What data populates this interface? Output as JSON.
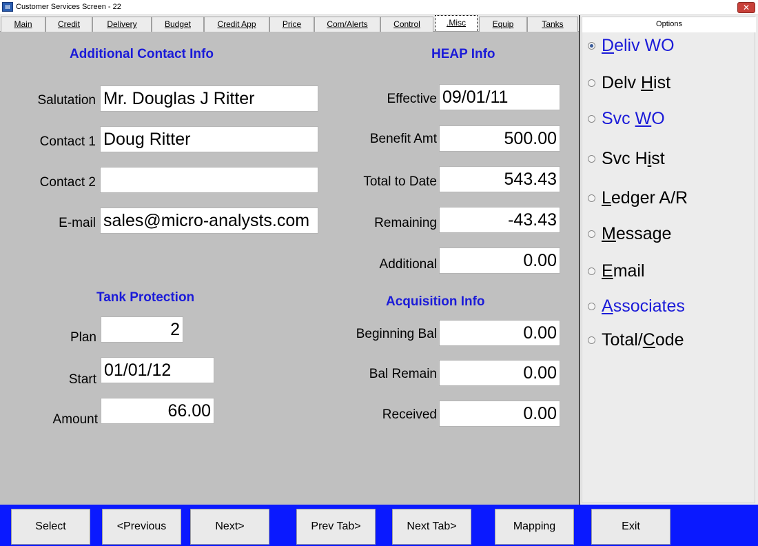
{
  "window": {
    "title": "Customer Services Screen - 22"
  },
  "tabs": [
    {
      "label": "Main"
    },
    {
      "label": "Credit"
    },
    {
      "label": "Delivery"
    },
    {
      "label": "Budget"
    },
    {
      "label": "Credit App"
    },
    {
      "label": "Price"
    },
    {
      "label": "Com/Alerts"
    },
    {
      "label": "Control"
    },
    {
      "label": ".Misc"
    },
    {
      "label": "Equip"
    },
    {
      "label": "Tanks"
    }
  ],
  "active_tab": ".Misc",
  "contact": {
    "title": "Additional Contact Info",
    "salutation_label": "Salutation",
    "salutation": "Mr. Douglas J Ritter",
    "contact1_label": "Contact 1",
    "contact1": "Doug Ritter",
    "contact2_label": "Contact 2",
    "contact2": "",
    "email_label": "E-mail",
    "email": "sales@micro-analysts.com"
  },
  "heap": {
    "title": "HEAP Info",
    "effective_label": "Effective",
    "effective": "09/01/11",
    "benefit_label": "Benefit Amt",
    "benefit": "500.00",
    "total_label": "Total to Date",
    "total": "543.43",
    "remaining_label": "Remaining",
    "remaining": "-43.43",
    "additional_label": "Additional",
    "additional": "0.00"
  },
  "tank_protection": {
    "title": "Tank Protection",
    "plan_label": "Plan",
    "plan": "2",
    "start_label": "Start",
    "start": "01/01/12",
    "amount_label": "Amount",
    "amount": "66.00"
  },
  "acquisition": {
    "title": "Acquisition Info",
    "beginning_label": "Beginning Bal",
    "beginning": "0.00",
    "remain_label": "Bal Remain",
    "remain": "0.00",
    "received_label": "Received",
    "received": "0.00"
  },
  "options": {
    "header": "Options",
    "items": [
      {
        "pre": "",
        "u": "D",
        "post": "eliv WO",
        "link": true,
        "checked": true
      },
      {
        "pre": "Delv ",
        "u": "H",
        "post": "ist",
        "link": false,
        "checked": false
      },
      {
        "pre": "Svc ",
        "u": "W",
        "post": "O",
        "link": true,
        "checked": false
      },
      {
        "pre": "Svc H",
        "u": "i",
        "post": "st",
        "link": false,
        "checked": false
      },
      {
        "pre": "",
        "u": "L",
        "post": "edger A/R",
        "link": false,
        "checked": false
      },
      {
        "pre": "",
        "u": "M",
        "post": "essage",
        "link": false,
        "checked": false
      },
      {
        "pre": "",
        "u": "E",
        "post": "mail",
        "link": false,
        "checked": false
      },
      {
        "pre": "",
        "u": "A",
        "post": "ssociates",
        "link": true,
        "checked": false
      },
      {
        "pre": "Total/",
        "u": "C",
        "post": "ode",
        "link": false,
        "checked": false
      }
    ]
  },
  "buttons": [
    {
      "label": "Select"
    },
    {
      "label": "<Previous"
    },
    {
      "label": "Next>"
    },
    {
      "label": "Prev Tab>"
    },
    {
      "label": "Next Tab>"
    },
    {
      "label": "Mapping"
    },
    {
      "label": "Exit"
    }
  ],
  "colors": {
    "section_title": "#1b1bd8",
    "panel_bg": "#c0c0c0",
    "button_bar": "#0a19ff"
  }
}
